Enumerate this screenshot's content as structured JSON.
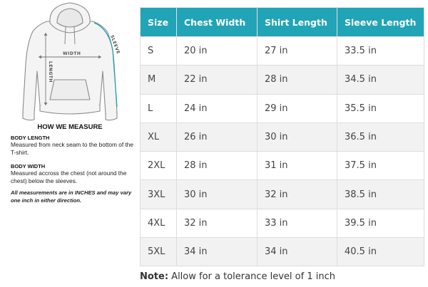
{
  "guide": {
    "diagram_labels": {
      "width": "WIDTH",
      "length": "LENGTH",
      "sleeve": "SLEEVE"
    },
    "title": "HOW WE MEASURE",
    "body_length_heading": "BODY LENGTH",
    "body_length_text": "Measured from neck seam to the bottom of the T-shirt.",
    "body_width_heading": "BODY WIDTH",
    "body_width_text": "Measured accross the chest (not around the chest) below the sleeves.",
    "footnote": "All measurements are in INCHES and may vary one inch in either direction."
  },
  "table": {
    "headers": [
      "Size",
      "Chest Width",
      "Shirt Length",
      "Sleeve Length"
    ],
    "rows": [
      [
        "S",
        "20 in",
        "27 in",
        "33.5 in"
      ],
      [
        "M",
        "22 in",
        "28 in",
        "34.5 in"
      ],
      [
        "L",
        "24 in",
        "29 in",
        "35.5 in"
      ],
      [
        "XL",
        "26 in",
        "30 in",
        "36.5 in"
      ],
      [
        "2XL",
        "28 in",
        "31 in",
        "37.5 in"
      ],
      [
        "3XL",
        "30 in",
        "32 in",
        "38.5 in"
      ],
      [
        "4XL",
        "32 in",
        "33 in",
        "39.5 in"
      ],
      [
        "5XL",
        "34 in",
        "34 in",
        "40.5 in"
      ]
    ],
    "header_color": "#20a4b6"
  },
  "note": {
    "label": "Note:",
    "text": " Allow for a tolerance level of 1 inch"
  }
}
